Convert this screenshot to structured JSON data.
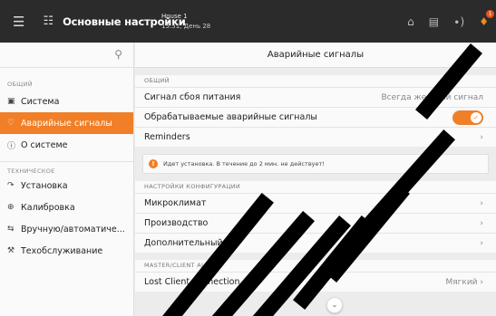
{
  "topbar": {
    "title": "Основные настройки",
    "house_name": "House 1",
    "house_status": "15:51, День 28",
    "badge_count": "1"
  },
  "sidebar": {
    "search_placeholder": "",
    "sections": [
      {
        "label": "ОБЩИЙ",
        "items": [
          {
            "label": "Система",
            "icon": "system-icon"
          },
          {
            "label": "Аварийные сигналы",
            "icon": "alarm-bell-icon",
            "active": true
          },
          {
            "label": "О системе",
            "icon": "info-icon"
          }
        ]
      },
      {
        "label": "ТЕХНИЧЕСКОЕ",
        "items": [
          {
            "label": "Установка",
            "icon": "install-icon"
          },
          {
            "label": "Калибровка",
            "icon": "calibration-icon"
          },
          {
            "label": "Вручную/автоматиче...",
            "icon": "manual-auto-icon"
          },
          {
            "label": "Техобслуживание",
            "icon": "tools-icon"
          }
        ]
      }
    ]
  },
  "main": {
    "header": "Аварийные сигналы",
    "general_group": "ОБЩИЙ",
    "power_failure_label": "Сигнал сбоя питания",
    "power_failure_value": "Всегда жесткий сигнал",
    "handled_alarms_label": "Обрабатываемые аварийные сигналы",
    "handled_alarms_on": true,
    "reminders_label": "Reminders",
    "notice_text": "Идет установка. В течение до 2 мин. не действует!",
    "config_group": "НАСТРОЙКИ КОНФИГУРАЦИИ",
    "config_items": [
      "Микроклимат",
      "Производство",
      "Дополнительный"
    ],
    "master_group": "MASTER/CLIENT ALARMS",
    "lost_client_label": "Lost Client connection",
    "lost_client_value": "Мягкий"
  },
  "colors": {
    "accent": "#f07f27",
    "topbar": "#2b2b2b",
    "sidebar_bg": "#fafafa",
    "main_bg": "#ececec"
  }
}
